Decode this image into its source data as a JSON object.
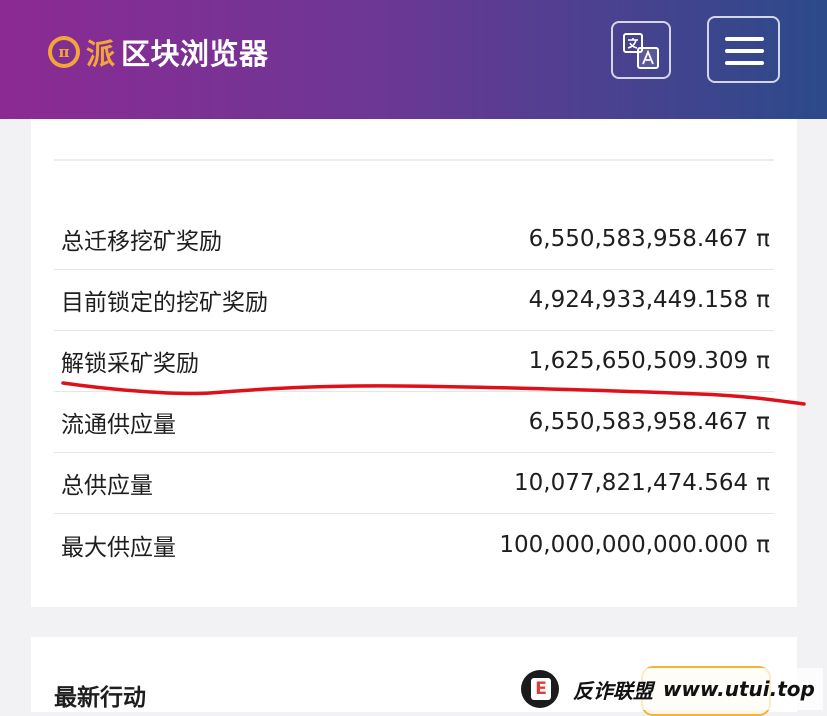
{
  "header": {
    "logo_glyph": "π",
    "brand_pi": "派",
    "brand_rest": "区块浏览器",
    "translate_icon": "translate-icon",
    "menu_icon": "hamburger-menu-icon"
  },
  "supply": {
    "currency_symbol": "π",
    "rows": [
      {
        "label": "总迁移挖矿奖励",
        "value": "6,550,583,958.467",
        "unit": "π"
      },
      {
        "label": "目前锁定的挖矿奖励",
        "value": "4,924,933,449.158",
        "unit": "π"
      },
      {
        "label": "解锁采矿奖励",
        "value": "1,625,650,509.309",
        "unit": "π"
      },
      {
        "label": "流通供应量",
        "value": "6,550,583,958.467",
        "unit": "π"
      },
      {
        "label": "总供应量",
        "value": "10,077,821,474.564",
        "unit": "π"
      },
      {
        "label": "最大供应量",
        "value": "100,000,000,000.000",
        "unit": "π"
      }
    ]
  },
  "latest": {
    "title": "最新行动"
  },
  "watermark": {
    "logo_glyph": "E",
    "text": "反诈联盟",
    "url": "www.utui.top"
  },
  "colors": {
    "header_start": "#8c2a93",
    "header_end": "#2b4a8a",
    "brand_accent": "#f3a53a",
    "annotation_red": "#e0101a"
  }
}
